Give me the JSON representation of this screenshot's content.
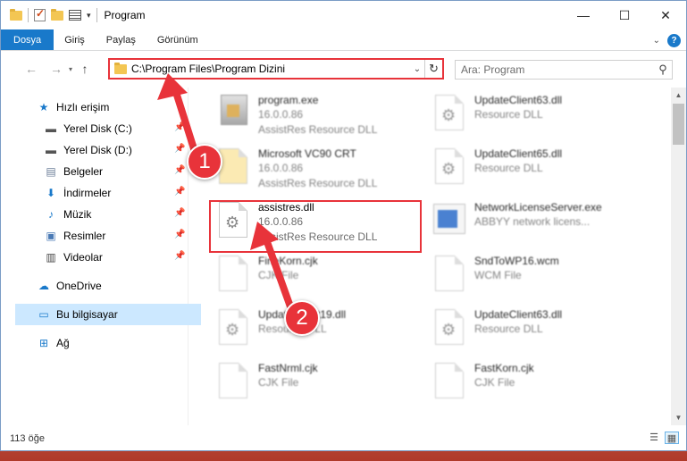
{
  "window": {
    "title": "Program",
    "controls": {
      "minimize": "—",
      "maximize": "☐",
      "close": "✕"
    }
  },
  "ribbon": {
    "tabs": [
      "Dosya",
      "Giriş",
      "Paylaş",
      "Görünüm"
    ]
  },
  "address": {
    "path": "C:\\Program Files\\Program Dizini",
    "search_placeholder": "Ara: Program"
  },
  "nav": {
    "items": [
      {
        "label": "Hızlı erişim"
      },
      {
        "label": "Yerel Disk (C:)"
      },
      {
        "label": "Yerel Disk (D:)"
      },
      {
        "label": "Belgeler"
      },
      {
        "label": "İndirmeler"
      },
      {
        "label": "Müzik"
      },
      {
        "label": "Resimler"
      },
      {
        "label": "Videolar"
      },
      {
        "label": "OneDrive"
      },
      {
        "label": "Bu bilgisayar"
      },
      {
        "label": "Ağ"
      }
    ]
  },
  "files": [
    {
      "name": "program.exe",
      "line2": "16.0.0.86",
      "line3": "AssistRes Resource DLL"
    },
    {
      "name": "UpdateClient63.dll",
      "line2": "Resource DLL",
      "line3": ""
    },
    {
      "name": "Microsoft VC90 CRT",
      "line2": "16.0.0.86",
      "line3": "AssistRes Resource DLL"
    },
    {
      "name": "UpdateClient65.dll",
      "line2": "Resource DLL",
      "line3": ""
    },
    {
      "name": "assistres.dll",
      "line2": "16.0.0.86",
      "line3": "AssistRes Resource DLL"
    },
    {
      "name": "NetworkLicenseServer.exe",
      "line2": "ABBYY network licens...",
      "line3": ""
    },
    {
      "name": "FineKorn.cjk",
      "line2": "CJK File",
      "line3": ""
    },
    {
      "name": "SndToWP16.wcm",
      "line2": "WCM File",
      "line3": ""
    },
    {
      "name": "UpdateClient19.dll",
      "line2": "Resource DLL",
      "line3": ""
    },
    {
      "name": "UpdateClient63.dll",
      "line2": "Resource DLL",
      "line3": ""
    },
    {
      "name": "FastNrml.cjk",
      "line2": "CJK File",
      "line3": ""
    },
    {
      "name": "FastKorn.cjk",
      "line2": "CJK File",
      "line3": ""
    }
  ],
  "markers": {
    "one": "1",
    "two": "2"
  },
  "status": {
    "count": "113 öğe"
  },
  "colors": {
    "accent": "#1979ca",
    "highlight": "#e8333a",
    "selected": "#cce8ff"
  }
}
